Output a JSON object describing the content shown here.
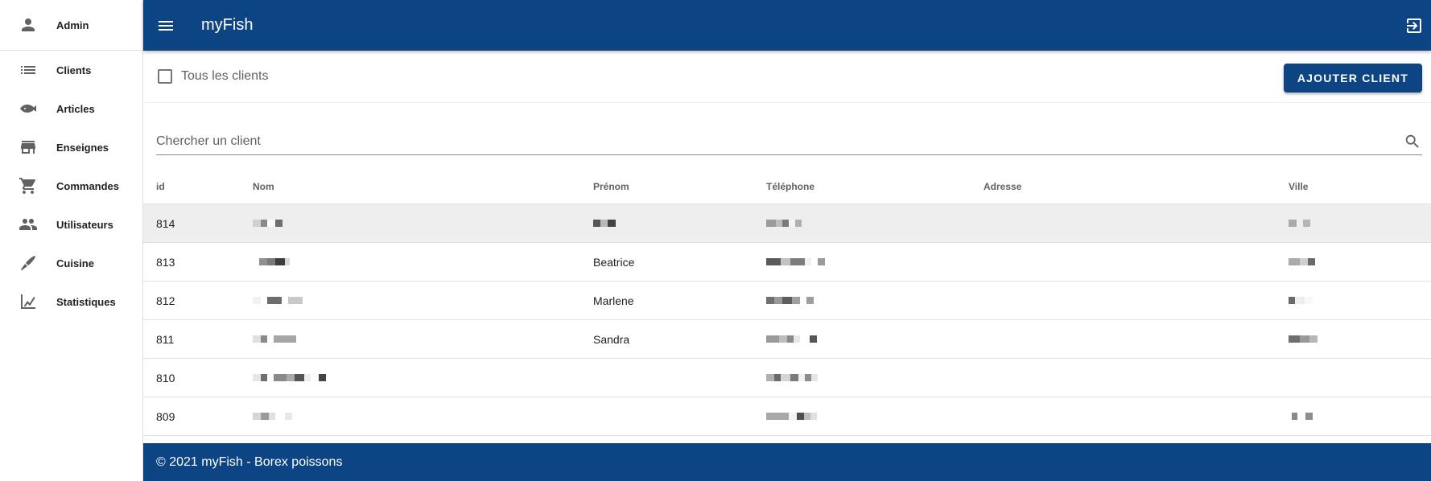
{
  "sidebar": {
    "user": {
      "label": "Admin",
      "icon": "person-icon"
    },
    "items": [
      {
        "label": "Clients",
        "icon": "list-icon"
      },
      {
        "label": "Articles",
        "icon": "fish-icon"
      },
      {
        "label": "Enseignes",
        "icon": "store-icon"
      },
      {
        "label": "Commandes",
        "icon": "cart-icon"
      },
      {
        "label": "Utilisateurs",
        "icon": "people-icon"
      },
      {
        "label": "Cuisine",
        "icon": "knife-icon"
      },
      {
        "label": "Statistiques",
        "icon": "chart-icon"
      }
    ]
  },
  "header": {
    "title": "myFish"
  },
  "filter": {
    "all_clients_label": "Tous les clients",
    "checked": false
  },
  "toolbar": {
    "add_label": "AJOUTER CLIENT"
  },
  "search": {
    "placeholder": "Chercher un client"
  },
  "table": {
    "columns": [
      "id",
      "Nom",
      "Prénom",
      "Téléphone",
      "Adresse",
      "Ville"
    ],
    "rows": [
      {
        "id": "814",
        "prenom": "",
        "selected": true
      },
      {
        "id": "813",
        "prenom": "Beatrice",
        "selected": false
      },
      {
        "id": "812",
        "prenom": "Marlene",
        "selected": false
      },
      {
        "id": "811",
        "prenom": "Sandra",
        "selected": false
      },
      {
        "id": "810",
        "prenom": "",
        "selected": false
      },
      {
        "id": "809",
        "prenom": "",
        "selected": false
      }
    ]
  },
  "footer": {
    "text": "© 2021 myFish - Borex poissons"
  },
  "colors": {
    "primary": "#0d4584",
    "selected_row": "#eeeeee"
  }
}
